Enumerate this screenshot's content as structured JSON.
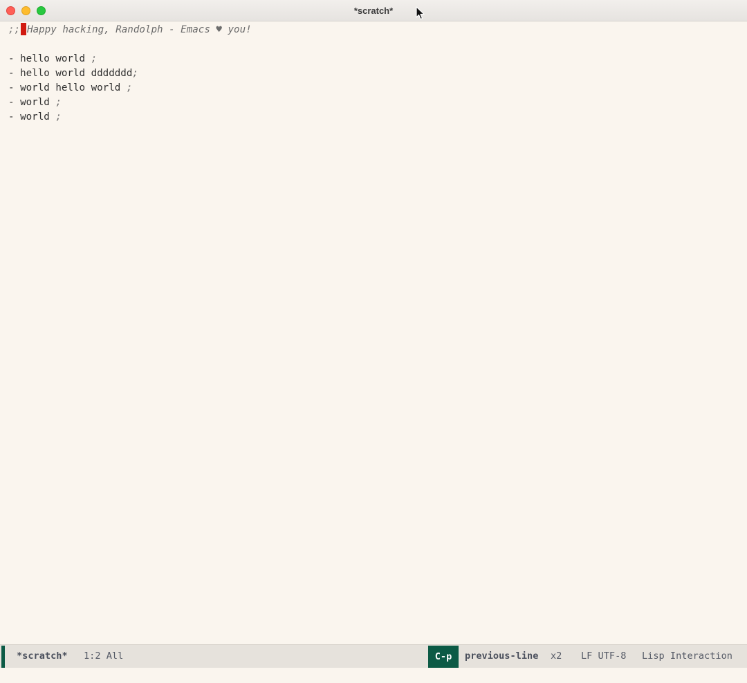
{
  "window": {
    "title": "*scratch*"
  },
  "buffer": {
    "comment_prefix": ";;",
    "comment_text": "Happy hacking, Randolph - Emacs ♥ you!",
    "lines": [
      {
        "text": "- hello world ",
        "trailing": ";"
      },
      {
        "text": "- hello world ddddddd",
        "trailing": ";"
      },
      {
        "text": "- world hello world ",
        "trailing": ";"
      },
      {
        "text": "- world ",
        "trailing": ";"
      },
      {
        "text": "- world ",
        "trailing": ";"
      }
    ]
  },
  "modeline": {
    "buffer_name": "*scratch*",
    "position": "1:2 All",
    "key": "C-p",
    "command": "previous-line",
    "count": "x2",
    "encoding": "LF UTF-8",
    "mode": "Lisp Interaction"
  },
  "colors": {
    "background": "#faf5ee",
    "cursor": "#d11a10",
    "accent": "#0c5a45",
    "modeline_bg": "#e6e2dc"
  },
  "icons": {
    "close": "close-icon",
    "minimize": "minimize-icon",
    "maximize": "maximize-icon",
    "pointer": "mouse-pointer-icon"
  }
}
